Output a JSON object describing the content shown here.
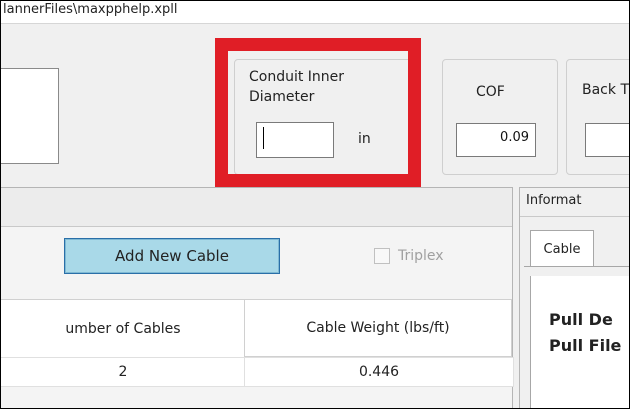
{
  "window": {
    "title_fragment": "lannerFiles\\maxpphelp.xpll"
  },
  "conduit": {
    "label": "Conduit Inner Diameter",
    "value": "",
    "unit": "in"
  },
  "cof": {
    "label": "COF",
    "value": "0.09"
  },
  "back": {
    "label": "Back T"
  },
  "toolbar": {
    "add_cable_label": "Add New Cable",
    "triplex_label": "Triplex",
    "triplex_checked": false
  },
  "table": {
    "headers": [
      "umber of Cables",
      "Cable Weight (lbs/ft)"
    ],
    "rows": [
      {
        "num_cables": "2",
        "weight": "0.446"
      }
    ]
  },
  "info": {
    "title": "Informat",
    "tabs": [
      {
        "label": "Cable"
      }
    ],
    "lines": [
      "Pull De",
      "Pull File"
    ]
  },
  "highlight": {
    "color": "#e01e26"
  }
}
